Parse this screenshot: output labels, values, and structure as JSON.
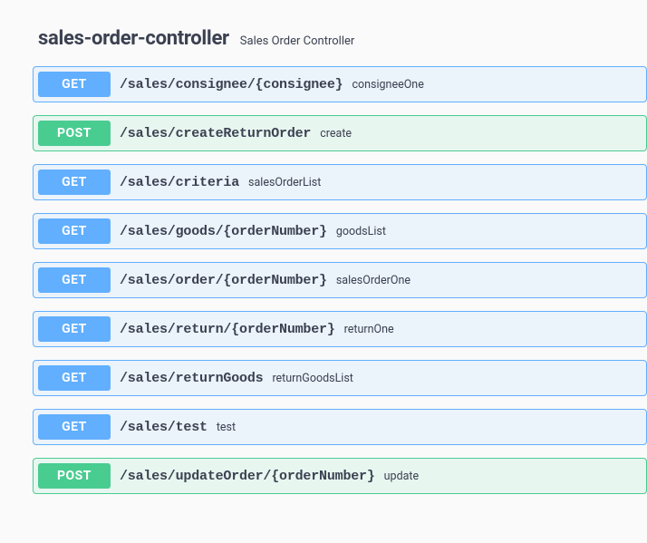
{
  "tag": {
    "name": "sales-order-controller",
    "description": "Sales Order Controller"
  },
  "operations": [
    {
      "method": "GET",
      "path": "/sales/consignee/{consignee}",
      "summary": "consigneeOne"
    },
    {
      "method": "POST",
      "path": "/sales/createReturnOrder",
      "summary": "create"
    },
    {
      "method": "GET",
      "path": "/sales/criteria",
      "summary": "salesOrderList"
    },
    {
      "method": "GET",
      "path": "/sales/goods/{orderNumber}",
      "summary": "goodsList"
    },
    {
      "method": "GET",
      "path": "/sales/order/{orderNumber}",
      "summary": "salesOrderOne"
    },
    {
      "method": "GET",
      "path": "/sales/return/{orderNumber}",
      "summary": "returnOne"
    },
    {
      "method": "GET",
      "path": "/sales/returnGoods",
      "summary": "returnGoodsList"
    },
    {
      "method": "GET",
      "path": "/sales/test",
      "summary": "test"
    },
    {
      "method": "POST",
      "path": "/sales/updateOrder/{orderNumber}",
      "summary": "update"
    }
  ]
}
